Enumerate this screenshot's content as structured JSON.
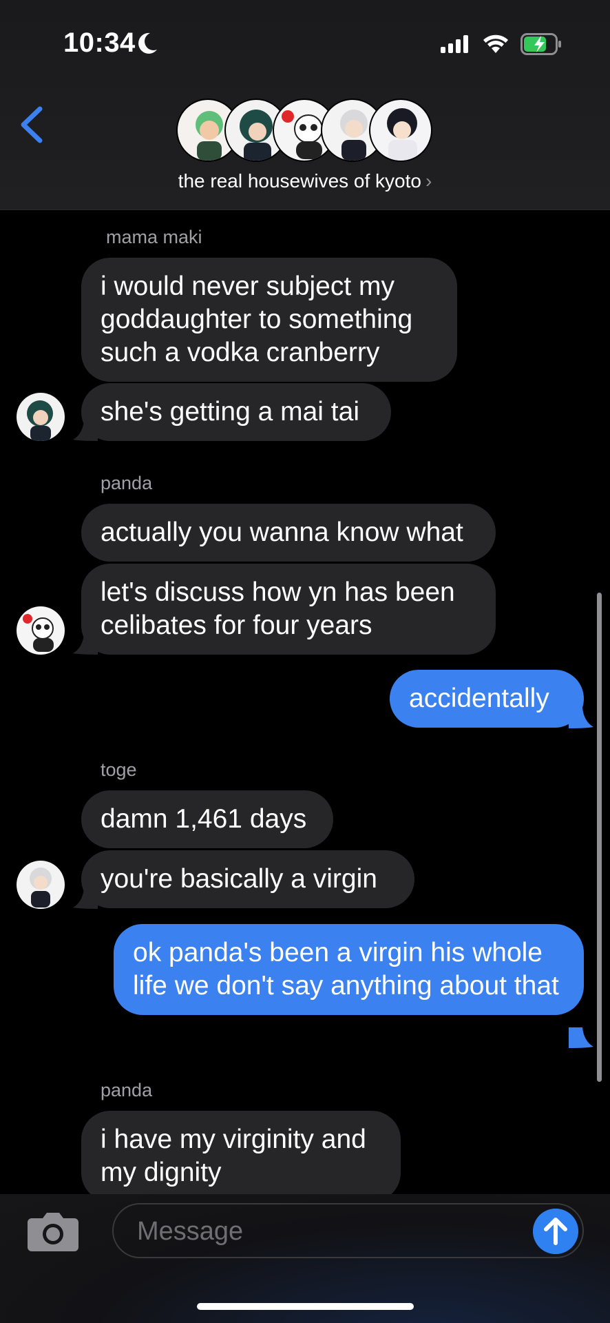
{
  "status_bar": {
    "time": "10:34"
  },
  "header": {
    "group_name": "the real housewives of kyoto"
  },
  "messages": {
    "m1_sender": "mama maki",
    "m1_b1": "i would never subject my goddaughter to something such a vodka cranberry",
    "m1_b2": "she's getting a mai tai",
    "m2_sender": "panda",
    "m2_b1": "actually you wanna know what",
    "m2_b2": "let's discuss how yn has been celibates for four years",
    "m3_out": "accidentally",
    "m4_sender": "toge",
    "m4_b1": "damn 1,461 days",
    "m4_b2": "you're basically a virgin",
    "m5_out": "ok panda's been a virgin his whole life we don't say anything about that",
    "m6_sender": "panda",
    "m6_b1": "i have my virginity and my dignity"
  },
  "composer": {
    "placeholder": "Message"
  },
  "colors": {
    "outgoing": "#3b82f0",
    "incoming": "#262628",
    "accent": "#2f80f0"
  }
}
